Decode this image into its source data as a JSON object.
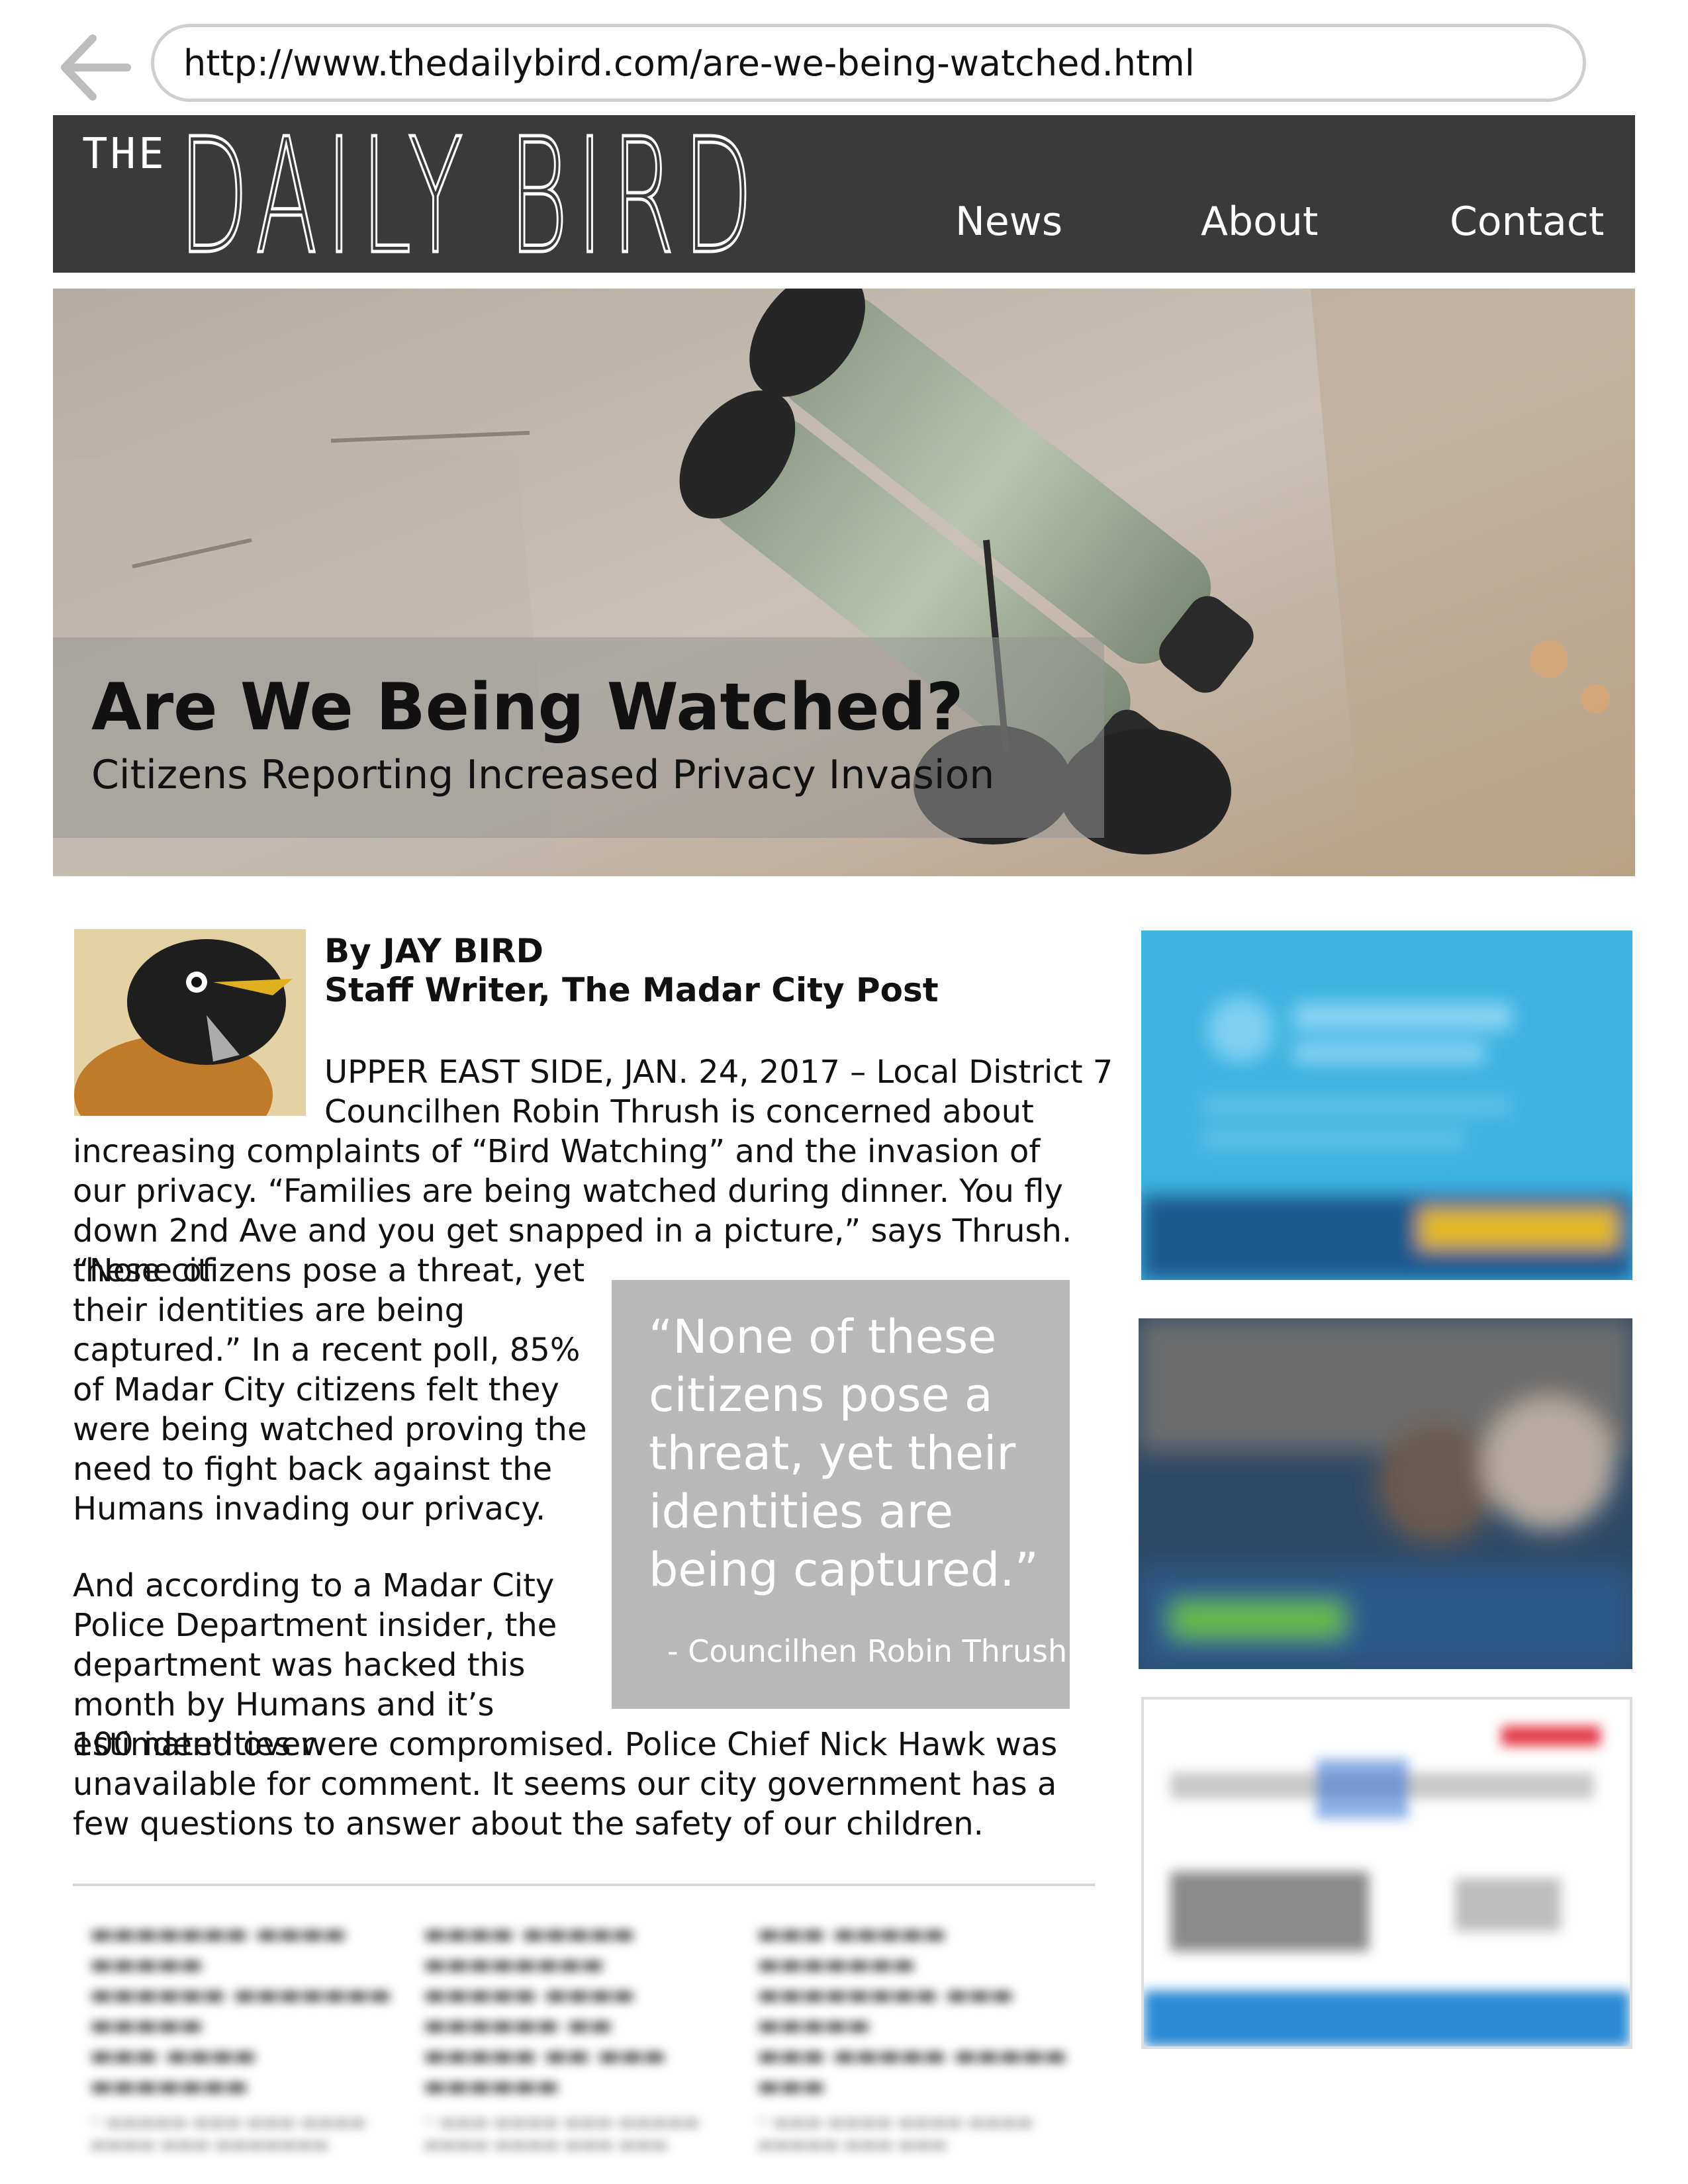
{
  "browser": {
    "url": "http://www.thedailybird.com/are-we-being-watched.html",
    "back_icon": "arrow-left-icon"
  },
  "site": {
    "logo_prefix": "THE",
    "logo_name": "DAILY BIRD",
    "nav": [
      "News",
      "About",
      "Contact"
    ],
    "header_color": "#3a3a3a"
  },
  "article": {
    "title": "Are We Being Watched?",
    "subtitle": "Citizens Reporting Increased Privacy Invasion",
    "byline": "By JAY BIRD",
    "author_role": "Staff Writer, The Madar City Post",
    "dateline_lines": [
      "UPPER EAST SIDE, JAN. 24, 2017 – Local District 7",
      "Councilhen Robin Thrush is concerned about"
    ],
    "body_1": "increasing complaints of “Bird Watching” and the invasion of our privacy. “Families are being watched during dinner. You fly down 2nd Ave and you get snapped in a picture,” says Thrush. “None of",
    "body_2": "these citizens pose a threat, yet their identities are being captured.” In a recent poll, 85% of Madar City citizens felt they were being watched proving the need to fight back against the Humans invading our privacy.",
    "body_3": "And according to a Madar City Police Department insider, the department was hacked this month by Humans and it’s estimated over",
    "body_4": "100 identities were compromised. Police Chief Nick Hawk was unavailable for comment. It seems our city government has a few questions to answer about the safety of our children.",
    "pull_quote": "“None of these citizens pose a threat, yet their identities are being captured.”",
    "pull_quote_author": "- Councilhen Robin Thrush"
  }
}
